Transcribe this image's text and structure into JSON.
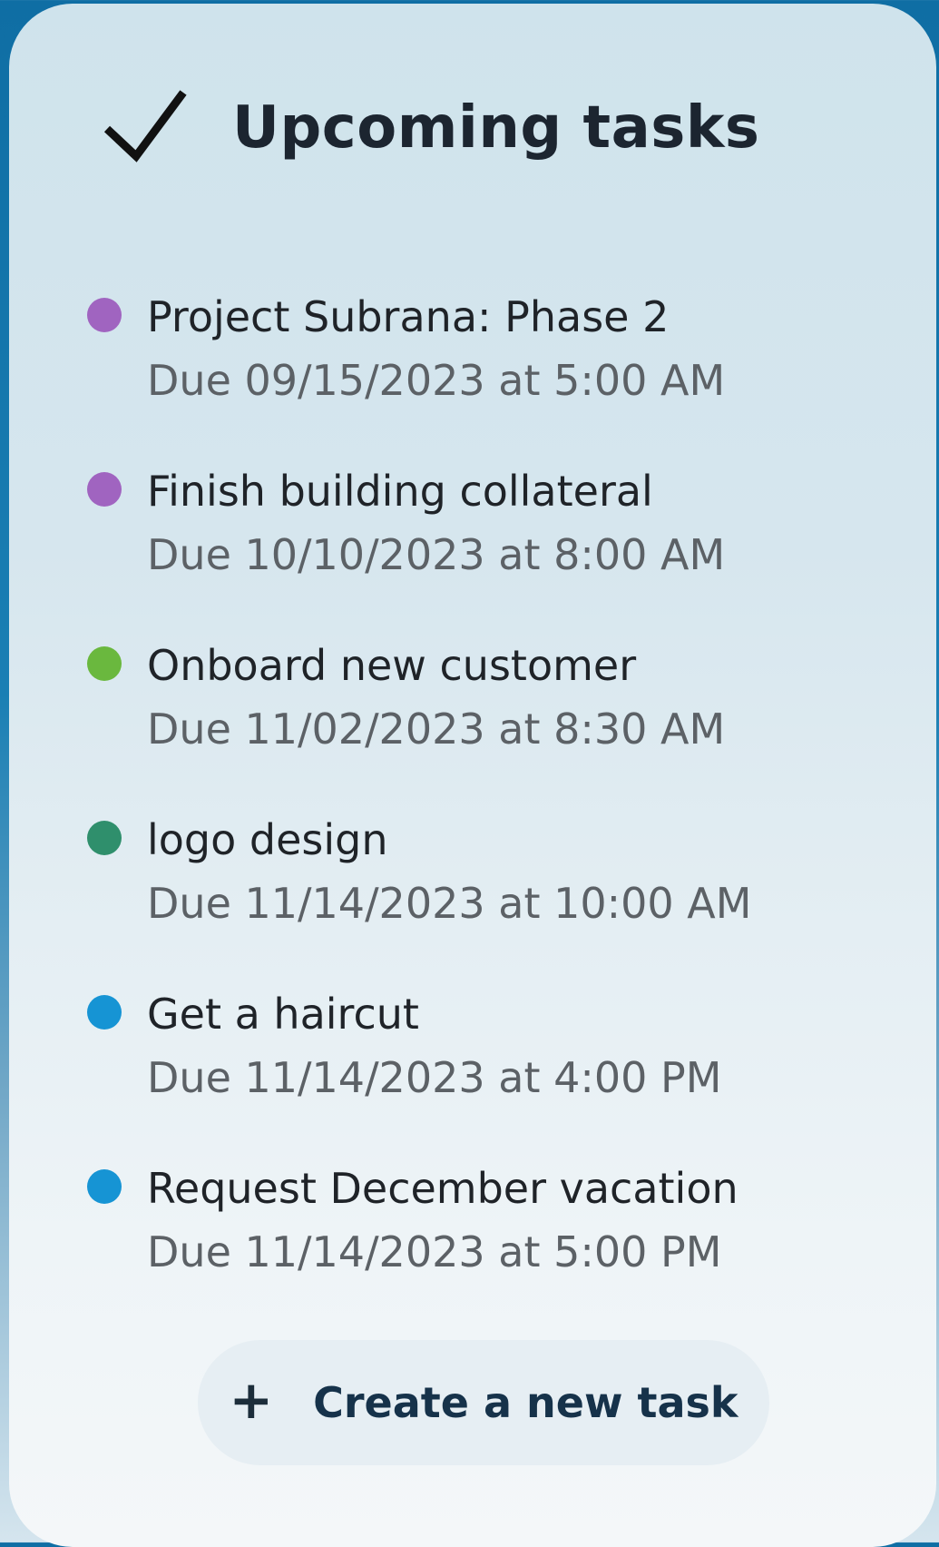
{
  "widget": {
    "title": "Upcoming tasks",
    "header_icon": "checkmark-icon"
  },
  "tasks": [
    {
      "title": "Project Subrana: Phase 2",
      "due": "Due 09/15/2023 at 5:00 AM",
      "color": "#a064c0"
    },
    {
      "title": "Finish building collateral",
      "due": "Due 10/10/2023 at 8:00 AM",
      "color": "#a064c0"
    },
    {
      "title": "Onboard new customer",
      "due": "Due 11/02/2023 at 8:30 AM",
      "color": "#6ab83e"
    },
    {
      "title": "logo design",
      "due": "Due 11/14/2023 at 10:00 AM",
      "color": "#2f8f6c"
    },
    {
      "title": "Get a haircut",
      "due": "Due 11/14/2023 at 4:00 PM",
      "color": "#1694d4"
    },
    {
      "title": "Request December vacation",
      "due": "Due 11/14/2023 at 5:00 PM",
      "color": "#1694d4"
    }
  ],
  "create_button": {
    "icon": "plus-icon",
    "label": "Create a new task"
  }
}
